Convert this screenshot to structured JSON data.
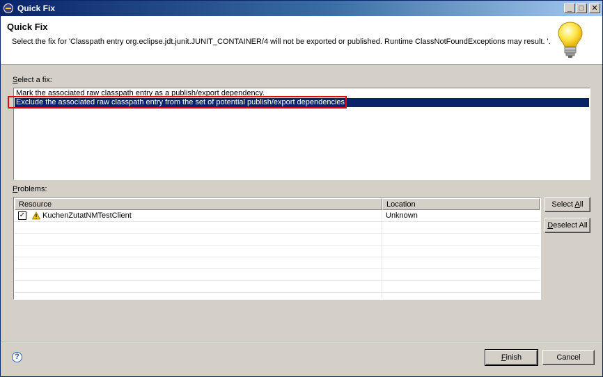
{
  "window": {
    "title": "Quick Fix",
    "minimize_glyph": "_",
    "maximize_glyph": "□",
    "close_glyph": "✕"
  },
  "header": {
    "title": "Quick Fix",
    "message": "Select the fix for 'Classpath entry org.eclipse.jdt.junit.JUNIT_CONTAINER/4 will not be exported or published. Runtime ClassNotFoundExceptions may result.  '.",
    "icon": "lightbulb-icon"
  },
  "fixes": {
    "label_mnemonic": "S",
    "label_rest": "elect a fix:",
    "items": [
      {
        "label": "Mark the associated raw classpath entry as a publish/export dependency."
      },
      {
        "label": "Exclude the associated raw classpath entry from the set of potential publish/export dependencies."
      }
    ],
    "selected_index": 1,
    "highlight_color": "#e8000b",
    "selection_color": "#0a246a"
  },
  "problems": {
    "label_mnemonic": "P",
    "label_rest": "roblems:",
    "columns": {
      "resource": "Resource",
      "location": "Location"
    },
    "rows": [
      {
        "checked": true,
        "icon": "warning-icon",
        "resource": "KuchenZutatNMTestClient",
        "location": "Unknown"
      }
    ],
    "empty_rows": 7
  },
  "buttons": {
    "select_all_prefix": "Select ",
    "select_all_mnemonic": "A",
    "select_all_suffix": "ll",
    "deselect_all_prefix": "",
    "deselect_all_mnemonic": "D",
    "deselect_all_suffix": "eselect All",
    "finish_mnemonic": "F",
    "finish_suffix": "inish",
    "cancel": "Cancel"
  },
  "footer": {
    "help_glyph": "?"
  }
}
